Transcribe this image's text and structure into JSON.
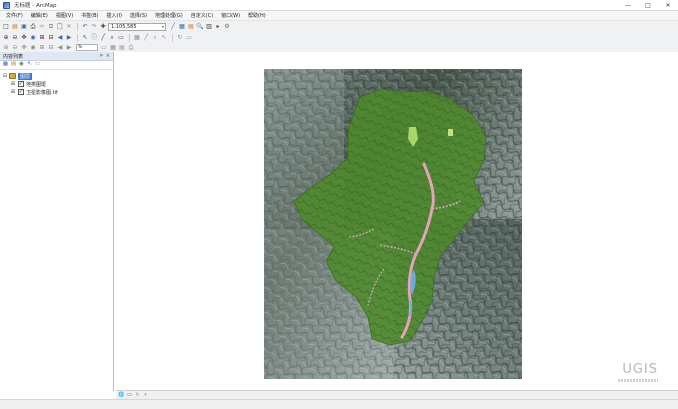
{
  "window": {
    "title": "无标题 - ArcMap",
    "controls": {
      "minimize": "—",
      "maximize": "□",
      "close": "✕"
    }
  },
  "menubar": {
    "items": [
      "文件(F)",
      "编辑(E)",
      "视图(V)",
      "书签(B)",
      "插入(I)",
      "选择(S)",
      "地理处理(G)",
      "自定义(C)",
      "窗口(W)",
      "帮助(H)"
    ]
  },
  "toolbar": {
    "scale_value": "1:105,585",
    "scale_dropdown_glyph": "▾",
    "zoom_percent": "%"
  },
  "toc": {
    "title": "内容列表",
    "pin_glyph": "ᴘ",
    "close_glyph": "×",
    "layers_label": "图层",
    "layer_items": [
      {
        "name": "地类图斑",
        "checked": "✓"
      },
      {
        "name": "卫星影像图.tif",
        "checked": "✓"
      }
    ],
    "expand_glyph": "⊟",
    "collapsed_glyph": "⊞"
  },
  "map": {
    "watermark": "UGIS",
    "colors": {
      "background": "#ffffff",
      "boundary_fill": "#4f8a2c",
      "settlement": "#e1a5b8",
      "water": "#6fa8dc"
    }
  },
  "icons": {
    "new": "□",
    "open": "▤",
    "save": "▣",
    "print": "⎙",
    "cut": "✂",
    "copy": "⧉",
    "paste": "📋",
    "delete": "✕",
    "undo": "↶",
    "redo": "↷",
    "add_data": "✚",
    "zoom_in": "⊕",
    "zoom_out": "⊖",
    "pan": "✥",
    "full_extent": "◉",
    "fixed_zoom_in": "⊞",
    "fixed_zoom_out": "⊟",
    "back": "◀",
    "forward": "▶",
    "select": "↖",
    "identify": "ⓘ",
    "measure": "╱",
    "find": "⌕",
    "html_popup": "▭",
    "table": "▦",
    "catalog": "▤",
    "search": "🔍",
    "toolbox": "▥",
    "python": "▸",
    "model": "⚙",
    "layout_view": "▭",
    "data_view": "🌐",
    "refresh": "↻",
    "pause": "⏸"
  }
}
